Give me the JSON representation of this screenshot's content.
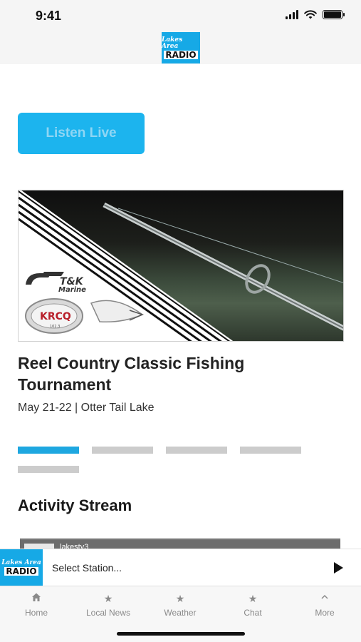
{
  "status_bar": {
    "time": "9:41"
  },
  "header": {
    "logo_top": "Lakes Area",
    "logo_bottom": "RADIO"
  },
  "listen_live": {
    "label": "Listen Live"
  },
  "banner": {
    "sponsor_text": "T&K Marine",
    "station_badge": "KRCQ",
    "station_freq": "102.3"
  },
  "event": {
    "title": "Reel Country Classic Fishing Tournament",
    "subtitle": "May 21-22 | Otter Tail Lake"
  },
  "pager": {
    "active_index": 0,
    "count": 5
  },
  "activity": {
    "title": "Activity Stream",
    "first_item_user": "lakestv3"
  },
  "player": {
    "logo_top": "Lakes Area",
    "logo_bottom": "RADIO",
    "select_label": "Select Station..."
  },
  "tabs": [
    {
      "label": "Home",
      "icon": "home-icon"
    },
    {
      "label": "Local News",
      "icon": "star-icon"
    },
    {
      "label": "Weather",
      "icon": "star-icon"
    },
    {
      "label": "Chat",
      "icon": "star-icon"
    },
    {
      "label": "More",
      "icon": "chevron-up-icon"
    }
  ],
  "colors": {
    "accent": "#16a9e6",
    "button": "#1cb4ee",
    "pager_active": "#1ea7e0",
    "pager_inactive": "#cccccc"
  }
}
